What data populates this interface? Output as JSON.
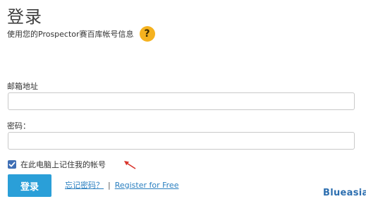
{
  "title": "登录",
  "subtitle": "使用您的Prospector赛百库帐号信息",
  "help": {
    "icon": "question-icon",
    "label": "?"
  },
  "email": {
    "label": "邮箱地址",
    "value": "",
    "placeholder": ""
  },
  "password": {
    "label": "密码：",
    "value": "",
    "placeholder": ""
  },
  "remember": {
    "label": "在此电脑上记住我的帐号",
    "checked": true
  },
  "login_button": "登录",
  "links": {
    "forgot": "忘记密码？",
    "separator": "|",
    "register": "Register for Free"
  },
  "brand": "Blueasia",
  "colors": {
    "primary": "#2a9fd8",
    "link": "#2a7fc0",
    "help_badge": "#f5b21f",
    "checkbox": "#3f6fb5",
    "annotation_arrow": "#d9342b"
  }
}
